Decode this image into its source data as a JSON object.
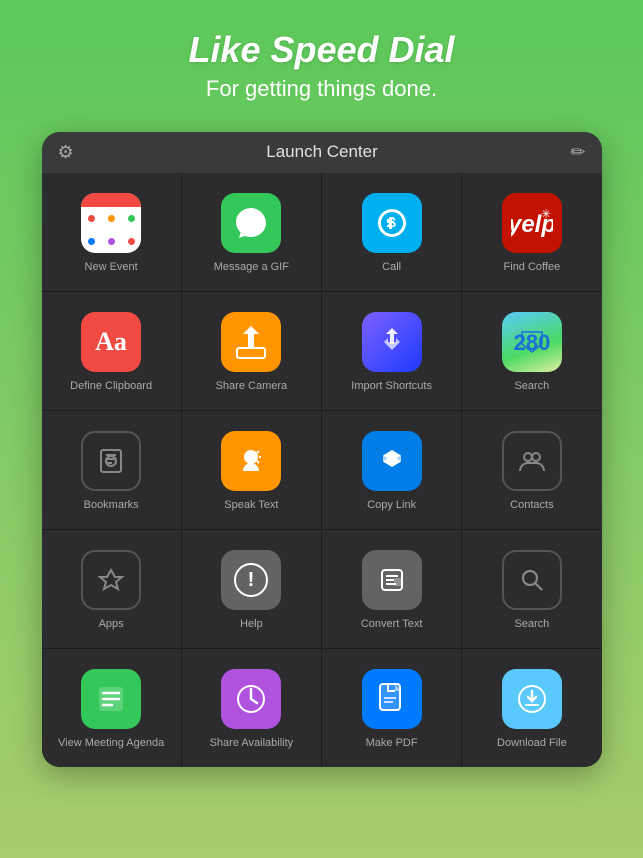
{
  "hero": {
    "title": "Like Speed Dial",
    "subtitle": "For getting things done."
  },
  "titleBar": {
    "label": "Launch Center",
    "settingsIcon": "⚙",
    "editIcon": "✏"
  },
  "grid": [
    [
      {
        "id": "new-event",
        "label": "New Event",
        "iconType": "calendar"
      },
      {
        "id": "message-gif",
        "label": "Message a GIF",
        "iconType": "message"
      },
      {
        "id": "call",
        "label": "Call",
        "iconType": "skype"
      },
      {
        "id": "find-coffee",
        "label": "Find Coffee",
        "iconType": "yelp"
      }
    ],
    [
      {
        "id": "define-clipboard",
        "label": "Define Clipboard",
        "iconType": "dictionary"
      },
      {
        "id": "share-camera",
        "label": "Share Camera",
        "iconType": "share"
      },
      {
        "id": "import-shortcuts",
        "label": "Import Shortcuts",
        "iconType": "shortcuts"
      },
      {
        "id": "search-maps",
        "label": "Search",
        "iconType": "maps"
      }
    ],
    [
      {
        "id": "bookmarks",
        "label": "Bookmarks",
        "iconType": "outline-book"
      },
      {
        "id": "speak-text",
        "label": "Speak Text",
        "iconType": "speak"
      },
      {
        "id": "copy-link",
        "label": "Copy Link",
        "iconType": "dropbox"
      },
      {
        "id": "contacts",
        "label": "Contacts",
        "iconType": "outline-contacts"
      }
    ],
    [
      {
        "id": "apps",
        "label": "Apps",
        "iconType": "outline-star"
      },
      {
        "id": "help",
        "label": "Help",
        "iconType": "help"
      },
      {
        "id": "convert-text",
        "label": "Convert Text",
        "iconType": "convert"
      },
      {
        "id": "search",
        "label": "Search",
        "iconType": "outline-search"
      }
    ],
    [
      {
        "id": "view-meeting-agenda",
        "label": "View Meeting Agenda",
        "iconType": "agenda"
      },
      {
        "id": "share-availability",
        "label": "Share Availability",
        "iconType": "availability"
      },
      {
        "id": "make-pdf",
        "label": "Make PDF",
        "iconType": "pdf"
      },
      {
        "id": "download-file",
        "label": "Download File",
        "iconType": "download"
      }
    ]
  ]
}
